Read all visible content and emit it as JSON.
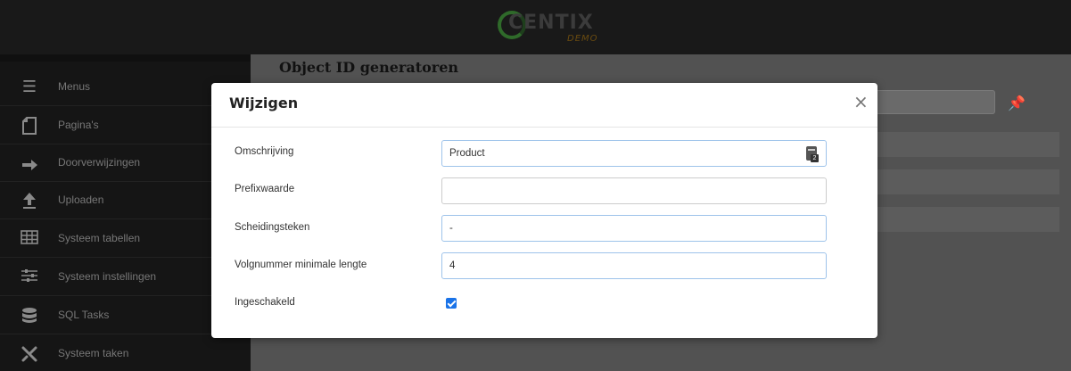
{
  "header": {
    "logo_text": "CENTIX",
    "logo_subtext": "DEMO"
  },
  "sidebar": {
    "items": [
      {
        "label": "Menus",
        "icon": "hamburger-icon"
      },
      {
        "label": "Pagina's",
        "icon": "page-icon"
      },
      {
        "label": "Doorverwijzingen",
        "icon": "redirect-arrow-icon"
      },
      {
        "label": "Uploaden",
        "icon": "upload-icon"
      },
      {
        "label": "Systeem tabellen",
        "icon": "table-icon"
      },
      {
        "label": "Systeem instellingen",
        "icon": "sliders-icon"
      },
      {
        "label": "SQL Tasks",
        "icon": "database-icon"
      },
      {
        "label": "Systeem taken",
        "icon": "tools-icon"
      }
    ]
  },
  "main": {
    "title": "Object ID generatoren"
  },
  "modal": {
    "title": "Wijzigen",
    "close_label": "×",
    "fields": {
      "omschrijving": {
        "label": "Omschrijving",
        "value": "Product"
      },
      "prefix": {
        "label": "Prefixwaarde",
        "value": ""
      },
      "scheiding": {
        "label": "Scheidingsteken",
        "value": "-"
      },
      "volgnummer": {
        "label": "Volgnummer minimale lengte",
        "value": "4"
      },
      "ingeschakeld": {
        "label": "Ingeschakeld",
        "checked": true
      }
    }
  },
  "colors": {
    "checkbox": "#1a73e8",
    "focus_border": "#9ec3ea"
  }
}
